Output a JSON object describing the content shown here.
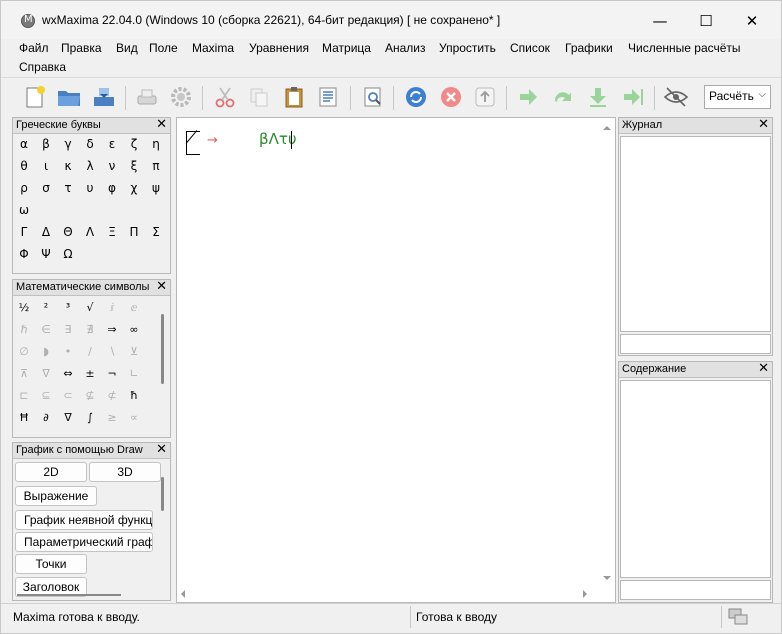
{
  "window": {
    "title": "wxMaxima 22.04.0 (Windows 10 (сборка 22621), 64-бит редакция) [ не сохранено* ]",
    "minimize": "—",
    "maximize": "☐",
    "close": "✕"
  },
  "menu": {
    "items": [
      "Файл",
      "Правка",
      "Вид",
      "Поле",
      "Maxima",
      "Уравнения",
      "Матрица",
      "Анализ",
      "Упростить",
      "Список",
      "Графики",
      "Численные расчёты",
      "Справка"
    ]
  },
  "toolbar": {
    "mode_select": "Расчёть",
    "mode_arrow": "⌵"
  },
  "greek_panel": {
    "title": "Греческие буквы",
    "close": "✕",
    "letters": [
      "α",
      "β",
      "γ",
      "δ",
      "ε",
      "ζ",
      "η",
      "θ",
      "ι",
      "κ",
      "λ",
      "ν",
      "ξ",
      "π",
      "ρ",
      "σ",
      "τ",
      "υ",
      "φ",
      "χ",
      "ψ",
      "ω",
      "Γ",
      "Δ",
      "Θ",
      "Λ",
      "Ξ",
      "Π",
      "Σ",
      "Φ",
      "Ψ",
      "Ω"
    ]
  },
  "math_panel": {
    "title": "Математические символы",
    "close": "✕",
    "symbols": [
      "½",
      "²",
      "³",
      "√",
      "ⅈ",
      "ⅇ",
      "ℏ",
      "∈",
      "∃",
      "∄",
      "⇒",
      "∞",
      "∅",
      "◗",
      "•",
      "/",
      "∖",
      "⊻",
      "⊼",
      "∇",
      "⇔",
      "±",
      "¬",
      "∟",
      "⊏",
      "⊆",
      "⊂",
      "⊈",
      "⊄",
      "ħ",
      "Ħ",
      "∂",
      "∇",
      "∫",
      "≥",
      "∝"
    ]
  },
  "draw_panel": {
    "title": "График с помощью Draw",
    "close": "✕",
    "buttons": [
      "2D",
      "3D",
      "Выражение",
      "График неявной функции",
      "Параметрический график",
      "Точки",
      "Заголовок"
    ]
  },
  "worksheet": {
    "prompt": "→",
    "input": "βΛτυ"
  },
  "journal_panel": {
    "title": "Журнал",
    "close": "✕"
  },
  "contents_panel": {
    "title": "Содержание",
    "close": "✕"
  },
  "status": {
    "left": "Maxima готова к вводу.",
    "right": "Готова к вводу"
  }
}
